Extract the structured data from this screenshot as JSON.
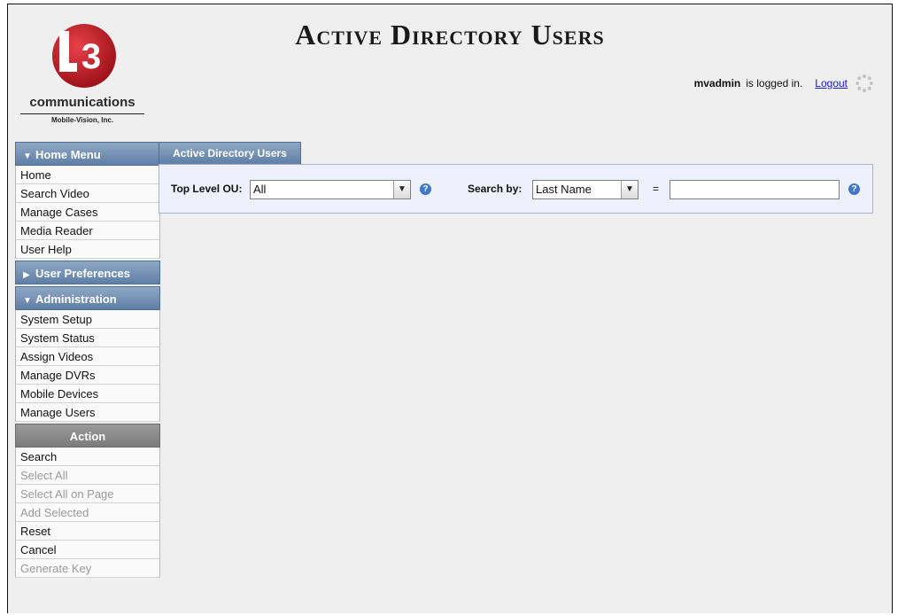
{
  "header": {
    "title": "Active Directory Users",
    "username": "mvadmin",
    "logged_in_text": "is logged in.",
    "logout_label": "Logout"
  },
  "logo": {
    "mark": "3",
    "word": "communications",
    "sub": "Mobile-Vision, Inc."
  },
  "sidebar": {
    "home_menu": {
      "title": "Home Menu",
      "items": [
        "Home",
        "Search Video",
        "Manage Cases",
        "Media Reader",
        "User Help"
      ]
    },
    "user_preferences": {
      "title": "User Preferences"
    },
    "administration": {
      "title": "Administration",
      "items": [
        "System Setup",
        "System Status",
        "Assign Videos",
        "Manage DVRs",
        "Mobile Devices",
        "Manage Users"
      ]
    },
    "action": {
      "title": "Action",
      "items": [
        {
          "label": "Search",
          "enabled": true
        },
        {
          "label": "Select All",
          "enabled": false
        },
        {
          "label": "Select All on Page",
          "enabled": false
        },
        {
          "label": "Add Selected",
          "enabled": false
        },
        {
          "label": "Reset",
          "enabled": true
        },
        {
          "label": "Cancel",
          "enabled": true
        },
        {
          "label": "Generate Key",
          "enabled": false
        }
      ]
    }
  },
  "main": {
    "tab_label": "Active Directory Users",
    "top_level_ou": {
      "label": "Top Level OU:",
      "value": "All"
    },
    "search_by": {
      "label": "Search by:",
      "value": "Last Name"
    },
    "equals": "=",
    "search_value": ""
  },
  "colors": {
    "menu_header": "#6f8db3",
    "action_header": "#8a8a8a",
    "panel_bg": "#eef0fb",
    "help_icon": "#3f78c8",
    "logo_red": "#c8202a"
  },
  "icons": [
    "collapse-arrow-icon",
    "expand-arrow-icon",
    "help-icon",
    "loading-spinner-icon",
    "chevron-down-icon"
  ]
}
